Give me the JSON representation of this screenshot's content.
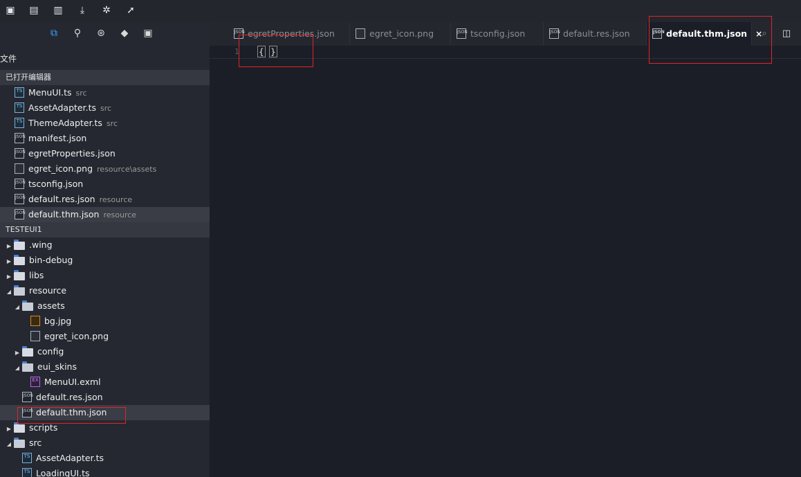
{
  "toolbar": {
    "icons": [
      "new-project-icon",
      "save-icon",
      "save-all-icon",
      "download-icon",
      "debug-icon",
      "launch-icon"
    ]
  },
  "sidebar": {
    "tabs": [
      "files-icon",
      "search-icon",
      "git-icon",
      "extensions-icon",
      "layout-icon"
    ],
    "files_label": "文件",
    "open_editors": {
      "title": "已打开编辑器",
      "items": [
        {
          "name": "MenuUI.ts",
          "hint": "src",
          "type": "ts"
        },
        {
          "name": "AssetAdapter.ts",
          "hint": "src",
          "type": "ts"
        },
        {
          "name": "ThemeAdapter.ts",
          "hint": "src",
          "type": "ts"
        },
        {
          "name": "manifest.json",
          "hint": "",
          "type": "json"
        },
        {
          "name": "egretProperties.json",
          "hint": "",
          "type": "json"
        },
        {
          "name": "egret_icon.png",
          "hint": "resource\\assets",
          "type": "png"
        },
        {
          "name": "tsconfig.json",
          "hint": "",
          "type": "json"
        },
        {
          "name": "default.res.json",
          "hint": "resource",
          "type": "json"
        },
        {
          "name": "default.thm.json",
          "hint": "resource",
          "type": "json"
        }
      ]
    },
    "project": {
      "title": "TESTEUI1",
      "items": [
        {
          "name": ".wing",
          "type": "folder",
          "depth": 0,
          "arrow": "▶"
        },
        {
          "name": "bin-debug",
          "type": "folder",
          "depth": 0,
          "arrow": "▶"
        },
        {
          "name": "libs",
          "type": "folder",
          "depth": 0,
          "arrow": "▶"
        },
        {
          "name": "resource",
          "type": "folder-open",
          "depth": 0,
          "arrow": "◢"
        },
        {
          "name": "assets",
          "type": "folder-open",
          "depth": 1,
          "arrow": "◢"
        },
        {
          "name": "bg.jpg",
          "type": "jpg",
          "depth": 2,
          "arrow": ""
        },
        {
          "name": "egret_icon.png",
          "type": "png",
          "depth": 2,
          "arrow": ""
        },
        {
          "name": "config",
          "type": "folder",
          "depth": 1,
          "arrow": "▶"
        },
        {
          "name": "eui_skins",
          "type": "folder-open",
          "depth": 1,
          "arrow": "◢"
        },
        {
          "name": "MenuUI.exml",
          "type": "exml",
          "depth": 2,
          "arrow": ""
        },
        {
          "name": "default.res.json",
          "type": "json",
          "depth": 1,
          "arrow": ""
        },
        {
          "name": "default.thm.json",
          "type": "json",
          "depth": 1,
          "arrow": ""
        },
        {
          "name": "scripts",
          "type": "folder",
          "depth": 0,
          "arrow": "▶"
        },
        {
          "name": "src",
          "type": "folder-open",
          "depth": 0,
          "arrow": "◢"
        },
        {
          "name": "AssetAdapter.ts",
          "type": "ts",
          "depth": 1,
          "arrow": ""
        },
        {
          "name": "LoadingUI.ts",
          "type": "ts",
          "depth": 1,
          "arrow": ""
        }
      ]
    }
  },
  "tabs": [
    {
      "name": "egretProperties.json",
      "type": "json"
    },
    {
      "name": "egret_icon.png",
      "type": "png"
    },
    {
      "name": "tsconfig.json",
      "type": "json"
    },
    {
      "name": "default.res.json",
      "type": "json"
    },
    {
      "name": "default.thm.json",
      "type": "json",
      "close": "×"
    }
  ],
  "tab_tools": [
    "preview-icon",
    "split-editor-icon"
  ],
  "editor": {
    "line_number": "1",
    "open_brace": "{",
    "close_brace": "}"
  }
}
